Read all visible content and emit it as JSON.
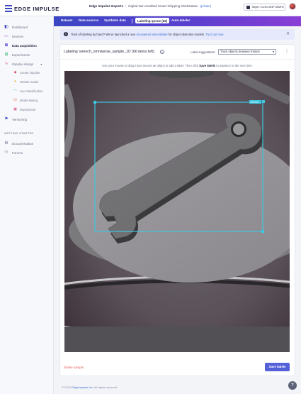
{
  "brand": {
    "name": "EDGE IMPULSE"
  },
  "breadcrumb": {
    "owner": "Edge Impulse Experts",
    "separator": "/",
    "project": "Digital-twin-enabled Smart Shipping Workstation",
    "badge": "(private)"
  },
  "target": {
    "label": "Target: Cortex-M4F 80MHz"
  },
  "sidebar": {
    "items": [
      {
        "label": "Dashboard",
        "icon": "dashboard-icon",
        "glyph": "◧"
      },
      {
        "label": "Devices",
        "icon": "devices-icon",
        "glyph": "▭"
      },
      {
        "label": "Data acquisition",
        "icon": "database-icon",
        "glyph": "≣"
      },
      {
        "label": "Experiments",
        "icon": "experiments-icon",
        "glyph": "⊞"
      },
      {
        "label": "Impulse design",
        "icon": "impulse-icon",
        "glyph": "∿"
      }
    ],
    "sub_items": [
      {
        "label": "Create impulse",
        "icon": "create-impulse-icon",
        "glyph": "◆"
      },
      {
        "label": "Retrain model",
        "icon": "retrain-icon",
        "glyph": "✦"
      },
      {
        "label": "Live classification",
        "icon": "live-classification-icon",
        "glyph": "◠"
      },
      {
        "label": "Model testing",
        "icon": "model-testing-icon",
        "glyph": "☑"
      },
      {
        "label": "Deployment",
        "icon": "deployment-icon",
        "glyph": "▣"
      }
    ],
    "versioning": {
      "label": "Versioning",
      "icon": "versioning-icon",
      "glyph": "⚑"
    },
    "section_title": "GETTING STARTED",
    "resources": [
      {
        "label": "Documentation",
        "icon": "documentation-icon",
        "glyph": "⚙"
      },
      {
        "label": "Forums",
        "icon": "forums-icon",
        "glyph": "⚇"
      }
    ]
  },
  "tabs": [
    {
      "label": "Dataset"
    },
    {
      "label": "Data sources"
    },
    {
      "label": "Synthetic data"
    },
    {
      "label": "Labeling queue (66)"
    },
    {
      "label": "Auto-labeler"
    }
  ],
  "banner": {
    "message": "Tired of labeling by hand? We've launched a new",
    "link1": "AI-powered auto-labeler",
    "message2": "for object detection models.",
    "link2": "Try it out now."
  },
  "labeling": {
    "title": "Labeling 'wrench_omniverse_sample_10' (66 items left)",
    "suggestions_label": "Label suggestions:",
    "suggestions_value": "Track objects between frames",
    "instructions_pre": "Use your mouse to drag a box around an object to add a label. Then click",
    "instructions_bold": "Save labels",
    "instructions_post": "to advance to the next item.",
    "bbox_label": "wrench",
    "delete_label": "Delete sample",
    "save_label": "Save labels"
  },
  "footer": {
    "copyright": "© 2024",
    "company": "EdgeImpulse Inc.",
    "rights": "All rights reserved"
  },
  "help": {
    "label": "?"
  },
  "colors": {
    "accent": "#5360d8",
    "tab_gradient_start": "#3b47c4",
    "tab_gradient_end": "#8a3fd6",
    "bbox": "#3ec6e0",
    "danger": "#e0605a"
  }
}
